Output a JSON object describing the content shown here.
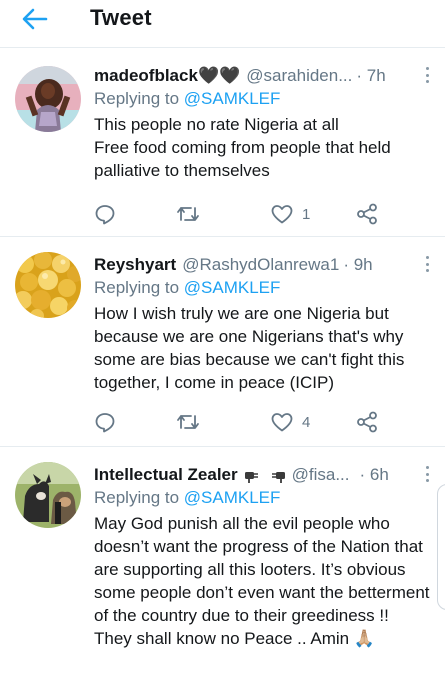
{
  "header": {
    "title": "Tweet"
  },
  "tweets": [
    {
      "name": "madeofblack",
      "name_emoji": "🖤🖤",
      "handle": "@sarahiden...",
      "time": "· 7h",
      "replying_label": "Replying to ",
      "replying_to": "@SAMKLEF",
      "text": "This people no rate Nigeria at all\nFree food coming from people that held palliative to themselves",
      "reply_count": "",
      "retweet_count": "",
      "like_count": "1"
    },
    {
      "name": "Reyshyart",
      "name_emoji": "",
      "handle": "@RashydOlanrewa1",
      "time": "· 9h",
      "replying_label": "Replying to ",
      "replying_to": "@SAMKLEF",
      "text": "How I wish truly we are one Nigeria but because we are one Nigerians that's why some are bias because we can't fight this together, I come in peace (ICIP)",
      "reply_count": "",
      "retweet_count": "",
      "like_count": "4"
    },
    {
      "name": "Intellectual Zealer",
      "name_emoji": "",
      "handle": "@fisa...",
      "time": "· 6h",
      "replying_label": "Replying to ",
      "replying_to": "@SAMKLEF",
      "text": "May God punish all the evil people who doesn’t want the progress of the Nation that are supporting all this looters. It’s obvious some people don’t even want the betterment of the country due to their greediness !!\nThey shall know no Peace .. Amin 🙏🏼",
      "reply_count": "",
      "retweet_count": "",
      "like_count": ""
    }
  ],
  "colors": {
    "accent": "#1da1f2",
    "secondary_text": "#657786",
    "icon": "#657786",
    "divider": "#e6ecf0"
  },
  "icons": {
    "back": "arrow-left-icon",
    "more": "more-vertical-icon",
    "reply": "comment-icon",
    "retweet": "retweet-icon",
    "like": "heart-icon",
    "share": "share-icon",
    "plug": "plug-icon"
  }
}
